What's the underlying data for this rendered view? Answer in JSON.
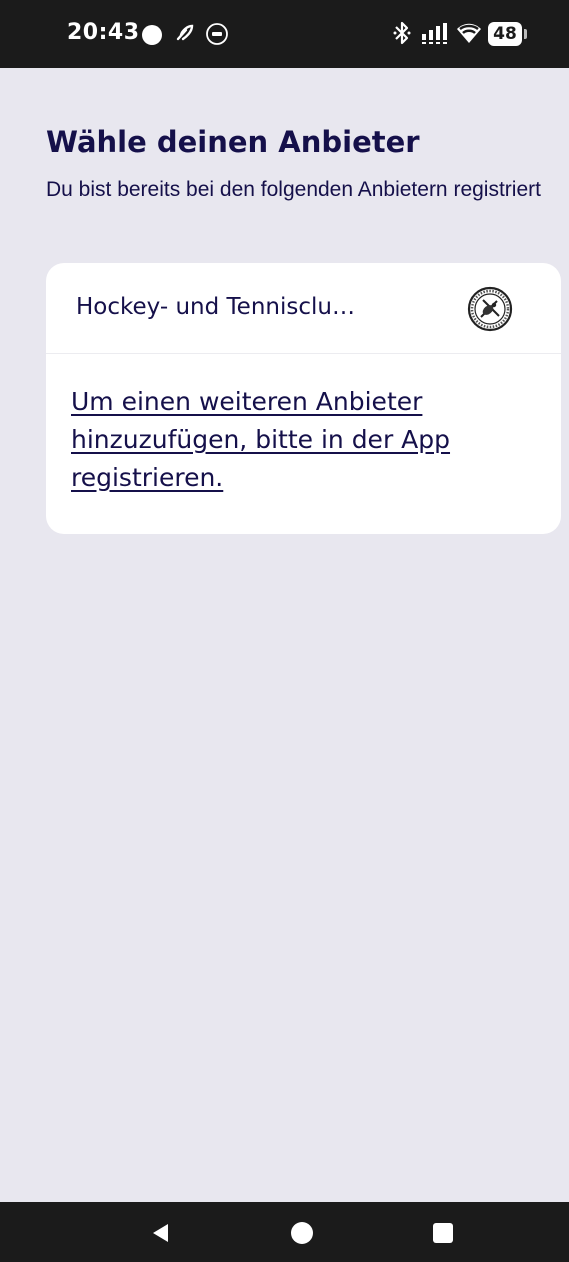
{
  "status_bar": {
    "time": "20:43",
    "battery": "48",
    "icons": [
      "record-dot-icon",
      "leaf-icon",
      "circle-badge-icon",
      "bluetooth-icon",
      "signal-icon",
      "wifi-icon",
      "battery-icon"
    ]
  },
  "page": {
    "title": "Wähle deinen Anbieter",
    "subtitle": "Du bist bereits bei den folgenden Anbietern registriert"
  },
  "providers": [
    {
      "name": "Hockey- und Tennisclu…",
      "logo": "club-logo-icon"
    }
  ],
  "register_link": "Um einen weiteren Anbieter hinzuzufügen, bitte in der App registrieren.",
  "colors": {
    "background": "#e8e7ef",
    "text": "#15104a",
    "card": "#ffffff",
    "system_bars": "#1b1b1b"
  },
  "nav_bar": {
    "icons": [
      "back-icon",
      "home-icon",
      "recents-icon"
    ]
  }
}
